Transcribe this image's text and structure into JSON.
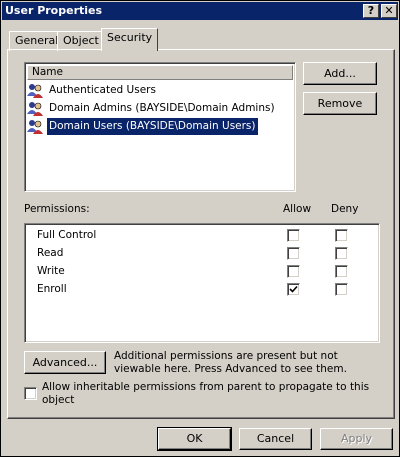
{
  "window": {
    "title": "User Properties",
    "help_label": "?",
    "close_label": "✕"
  },
  "tabs": [
    {
      "label": "General",
      "active": false
    },
    {
      "label": "Object",
      "active": false
    },
    {
      "label": "Security",
      "active": true
    }
  ],
  "names_list": {
    "header": "Name",
    "items": [
      {
        "label": "Authenticated Users",
        "selected": false,
        "icon": "users-icon"
      },
      {
        "label": "Domain Admins (BAYSIDE\\Domain Admins)",
        "selected": false,
        "icon": "users-icon"
      },
      {
        "label": "Domain Users (BAYSIDE\\Domain Users)",
        "selected": true,
        "icon": "users-icon"
      }
    ]
  },
  "buttons": {
    "add": "Add...",
    "remove": "Remove",
    "advanced": "Advanced...",
    "ok": "OK",
    "cancel": "Cancel",
    "apply": "Apply"
  },
  "permissions": {
    "label": "Permissions:",
    "allow_header": "Allow",
    "deny_header": "Deny",
    "rows": [
      {
        "name": "Full Control",
        "allow": false,
        "deny": false
      },
      {
        "name": "Read",
        "allow": false,
        "deny": false
      },
      {
        "name": "Write",
        "allow": false,
        "deny": false
      },
      {
        "name": "Enroll",
        "allow": true,
        "deny": false
      }
    ]
  },
  "advanced_note": {
    "line1": "Additional permissions are present but not",
    "line2": "viewable here. Press Advanced to see them."
  },
  "inherit": {
    "line1": "Allow inheritable permissions from parent to propagate to this",
    "line2": "object",
    "checked": false
  },
  "colors": {
    "titlebar": "#0a246a",
    "face": "#d4d0c8",
    "selection": "#0a246a"
  }
}
